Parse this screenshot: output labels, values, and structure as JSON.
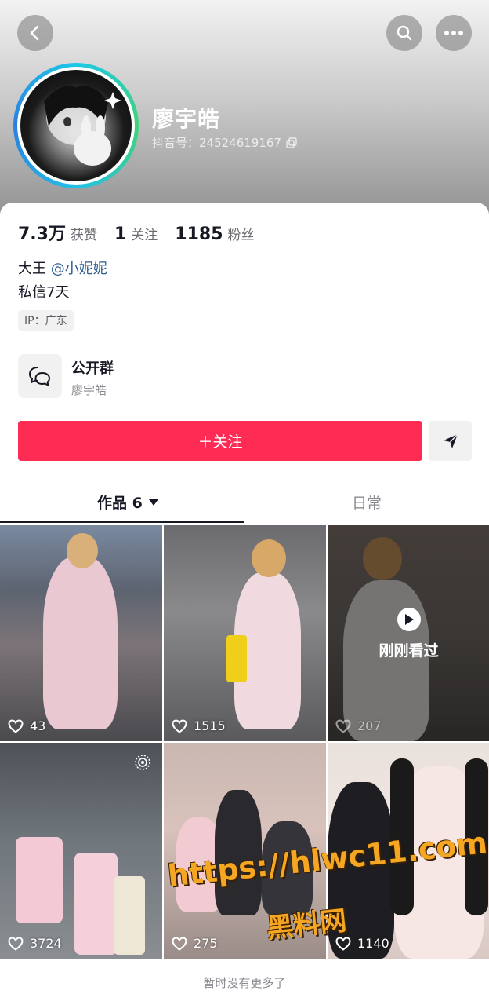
{
  "profile": {
    "nickname": "廖宇皓",
    "uid_text": "抖音号：24524619167"
  },
  "stats": [
    {
      "value": "7.3万",
      "label": "获赞"
    },
    {
      "value": "1",
      "label": "关注"
    },
    {
      "value": "1185",
      "label": "粉丝"
    }
  ],
  "bio": {
    "line1_prefix": "大王",
    "mention": "@小妮妮",
    "line2": "私信7天"
  },
  "ip_tag": "IP：广东",
  "group": {
    "title": "公开群",
    "subtitle": "廖宇皓"
  },
  "follow_button": "＋关注",
  "tabs": {
    "works": "作品 6",
    "daily": "日常"
  },
  "videos": [
    {
      "likes": "43"
    },
    {
      "likes": "1515"
    },
    {
      "likes": "207",
      "overlay": "刚刚看过"
    },
    {
      "likes": "3724"
    },
    {
      "likes": "275"
    },
    {
      "likes": "1140"
    }
  ],
  "watermark": {
    "url": "https://hlwc11.com",
    "name": "黑料网"
  },
  "footer": "暂时没有更多了",
  "colors": {
    "accent": "#fe2c55",
    "mention": "#2d5c8f",
    "watermark": "#f5a623"
  },
  "icons": [
    "back-icon",
    "search-icon",
    "more-icon",
    "copy-icon",
    "group-chat-icon",
    "send-icon",
    "caret-down-icon",
    "heart-icon",
    "play-icon",
    "live-icon"
  ]
}
